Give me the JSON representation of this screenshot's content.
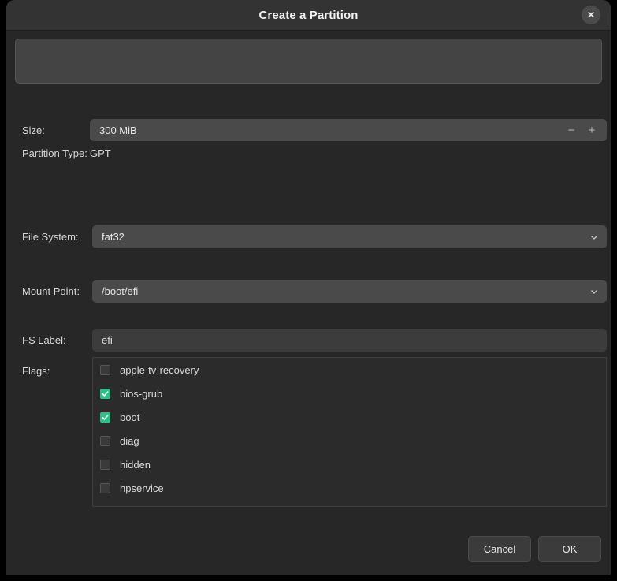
{
  "window": {
    "title": "Create a Partition",
    "close_label": "✕"
  },
  "form": {
    "size": {
      "label": "Size:",
      "value": "300 MiB",
      "decrement_label": "−",
      "increment_label": "+"
    },
    "partition_type": {
      "label": "Partition Type:",
      "value": "GPT"
    },
    "file_system": {
      "label": "File System:",
      "value": "fat32"
    },
    "mount_point": {
      "label": "Mount Point:",
      "value": "/boot/efi"
    },
    "fs_label": {
      "label": "FS Label:",
      "value": "efi"
    },
    "flags": {
      "label": "Flags:",
      "items": [
        {
          "name": "apple-tv-recovery",
          "checked": false
        },
        {
          "name": "bios-grub",
          "checked": true
        },
        {
          "name": "boot",
          "checked": true
        },
        {
          "name": "diag",
          "checked": false
        },
        {
          "name": "hidden",
          "checked": false
        },
        {
          "name": "hpservice",
          "checked": false
        }
      ]
    }
  },
  "footer": {
    "cancel_label": "Cancel",
    "ok_label": "OK"
  },
  "colors": {
    "accent_checked": "#2ec08a",
    "dialog_bg": "#272727",
    "titlebar_bg": "#333333",
    "field_bg": "#4a4a4a"
  }
}
